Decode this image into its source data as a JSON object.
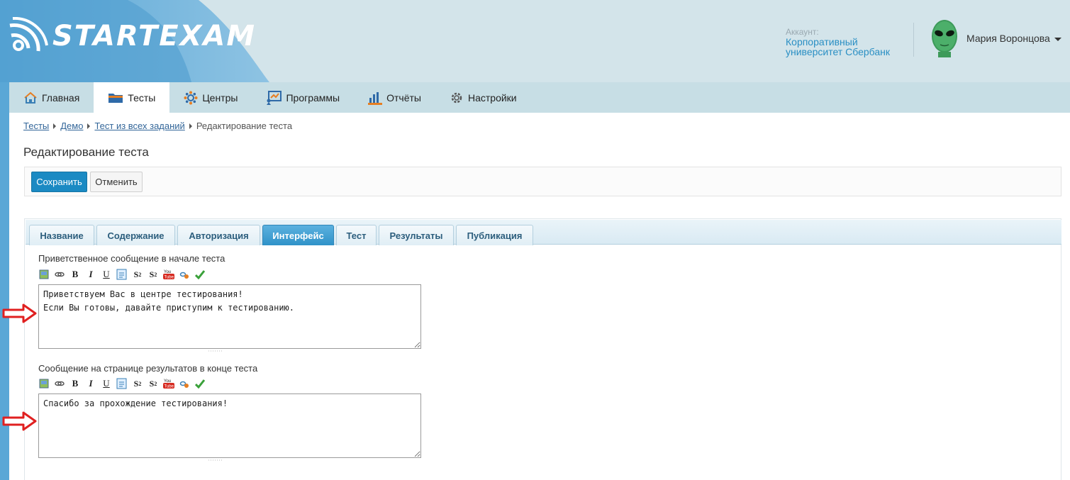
{
  "brand": {
    "logo_text": "STARTEXAM"
  },
  "account": {
    "label": "Аккаунт:",
    "name_line1": "Корпоративный",
    "name_line2": "университет Сбербанк"
  },
  "user": {
    "name": "Мария Воронцова"
  },
  "nav": {
    "items": [
      {
        "label": "Главная",
        "icon": "home-icon"
      },
      {
        "label": "Тесты",
        "icon": "folder-icon"
      },
      {
        "label": "Центры",
        "icon": "centers-icon"
      },
      {
        "label": "Программы",
        "icon": "programs-icon"
      },
      {
        "label": "Отчёты",
        "icon": "reports-icon"
      },
      {
        "label": "Настройки",
        "icon": "gear-icon"
      }
    ],
    "active": "Тесты"
  },
  "breadcrumb": {
    "items": [
      "Тесты",
      "Демо",
      "Тест из всех заданий"
    ],
    "current": "Редактирование теста"
  },
  "page": {
    "title": "Редактирование теста"
  },
  "toolbar": {
    "save_label": "Сохранить",
    "cancel_label": "Отменить"
  },
  "tabs": {
    "items": [
      "Название",
      "Содержание",
      "Авторизация",
      "Интерфейс",
      "Тест",
      "Результаты",
      "Публикация"
    ],
    "active": "Интерфейс"
  },
  "form": {
    "welcome": {
      "label": "Приветственное сообщение в начале теста",
      "value": "Приветствуем Вас в центре тестирования!\nЕсли Вы готовы, давайте приступим к тестированию."
    },
    "results": {
      "label": "Сообщение на странице результатов в конце теста",
      "value": "Спасибо за прохождение тестирования!"
    }
  },
  "editor_tools": [
    "image-icon",
    "link-icon",
    "bold-icon",
    "italic-icon",
    "underline-icon",
    "quote-icon",
    "subscript-icon",
    "superscript-icon",
    "youtube-icon",
    "unlink-icon",
    "check-icon"
  ],
  "colors": {
    "accent": "#1b8ac3",
    "tab_active": "#3d9fd3",
    "arrow": "#e02020"
  }
}
